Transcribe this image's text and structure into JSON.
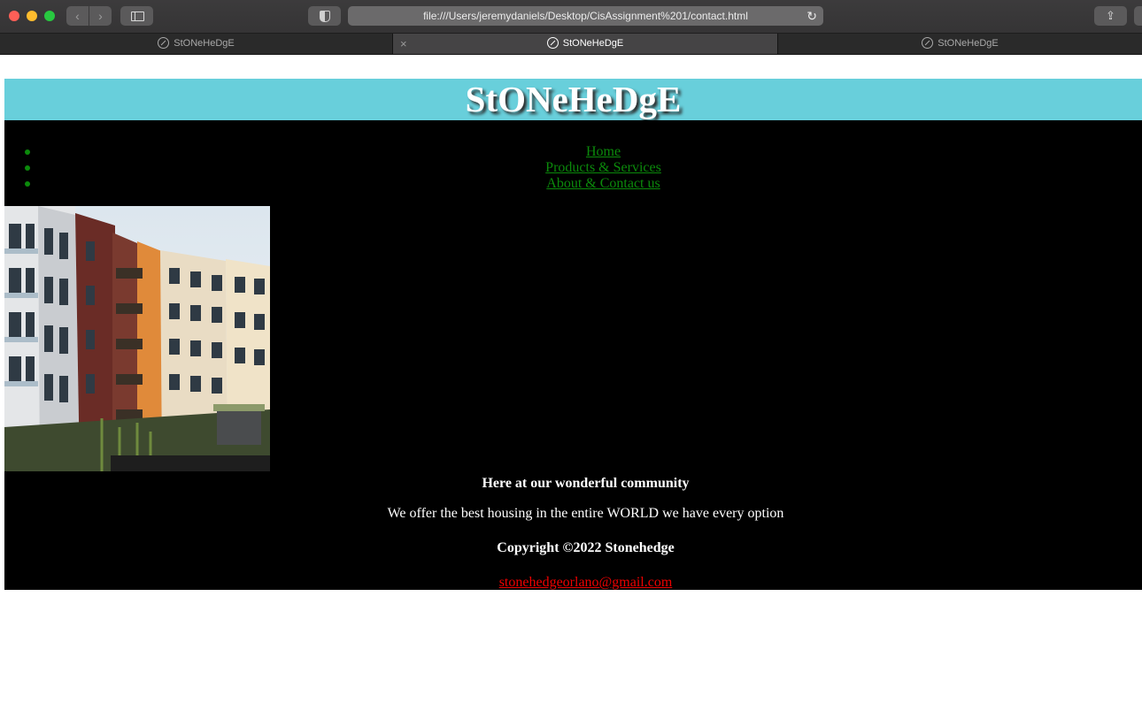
{
  "browser": {
    "url": "file:///Users/jeremydaniels/Desktop/CisAssignment%201/contact.html",
    "tabs": [
      {
        "title": "StONeHeDgE",
        "active": false
      },
      {
        "title": "StONeHeDgE",
        "active": true
      },
      {
        "title": "StONeHeDgE",
        "active": false
      }
    ],
    "icons": {
      "back": "chevron-left-icon",
      "forward": "chevron-right-icon",
      "sidebar": "sidebar-icon",
      "privacy": "shield-icon",
      "reload": "reload-icon",
      "share": "share-icon",
      "tab": "compass-icon",
      "close": "close-icon"
    }
  },
  "page": {
    "header_title": "StONeHeDgE",
    "nav": [
      {
        "label": "Home"
      },
      {
        "label": "Products & Services"
      },
      {
        "label": "About & Contact us"
      }
    ],
    "tagline": "Here at our wonderful community",
    "description": "We offer the best housing in the entire WORLD we have every option",
    "copyright": "Copyright ©2022 Stonehedge",
    "email": "stonehedgeorlano@gmail.com",
    "colors": {
      "header_bg": "#68cfdb",
      "body_bg": "#000000",
      "nav_link": "#0b8a0b",
      "email_link": "#ee0000"
    }
  }
}
